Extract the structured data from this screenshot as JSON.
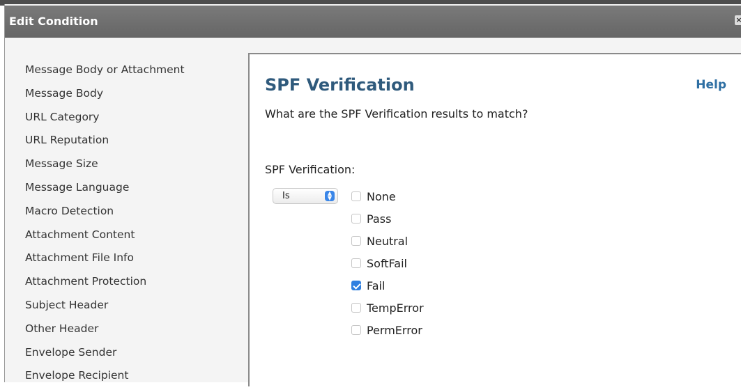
{
  "dialog": {
    "title": "Edit Condition",
    "close_label": "×"
  },
  "sidebar": {
    "items": [
      {
        "label": "Message Body or Attachment"
      },
      {
        "label": "Message Body"
      },
      {
        "label": "URL Category"
      },
      {
        "label": "URL Reputation"
      },
      {
        "label": "Message Size"
      },
      {
        "label": "Message Language"
      },
      {
        "label": "Macro Detection"
      },
      {
        "label": "Attachment Content"
      },
      {
        "label": "Attachment File Info"
      },
      {
        "label": "Attachment Protection"
      },
      {
        "label": "Subject Header"
      },
      {
        "label": "Other Header"
      },
      {
        "label": "Envelope Sender"
      },
      {
        "label": "Envelope Recipient"
      }
    ]
  },
  "panel": {
    "heading": "SPF Verification",
    "help_label": "Help",
    "question": "What are the SPF Verification results to match?",
    "field_label": "SPF Verification:",
    "operator": {
      "selected": "Is"
    },
    "options": [
      {
        "label": "None",
        "checked": false
      },
      {
        "label": "Pass",
        "checked": false
      },
      {
        "label": "Neutral",
        "checked": false
      },
      {
        "label": "SoftFail",
        "checked": false
      },
      {
        "label": "Fail",
        "checked": true
      },
      {
        "label": "TempError",
        "checked": false
      },
      {
        "label": "PermError",
        "checked": false
      }
    ]
  },
  "colors": {
    "titlebar": "#6e6e6e",
    "heading": "#2f5a7c",
    "help_link": "#2e6fa3",
    "checkbox_checked": "#2f7fe0"
  }
}
